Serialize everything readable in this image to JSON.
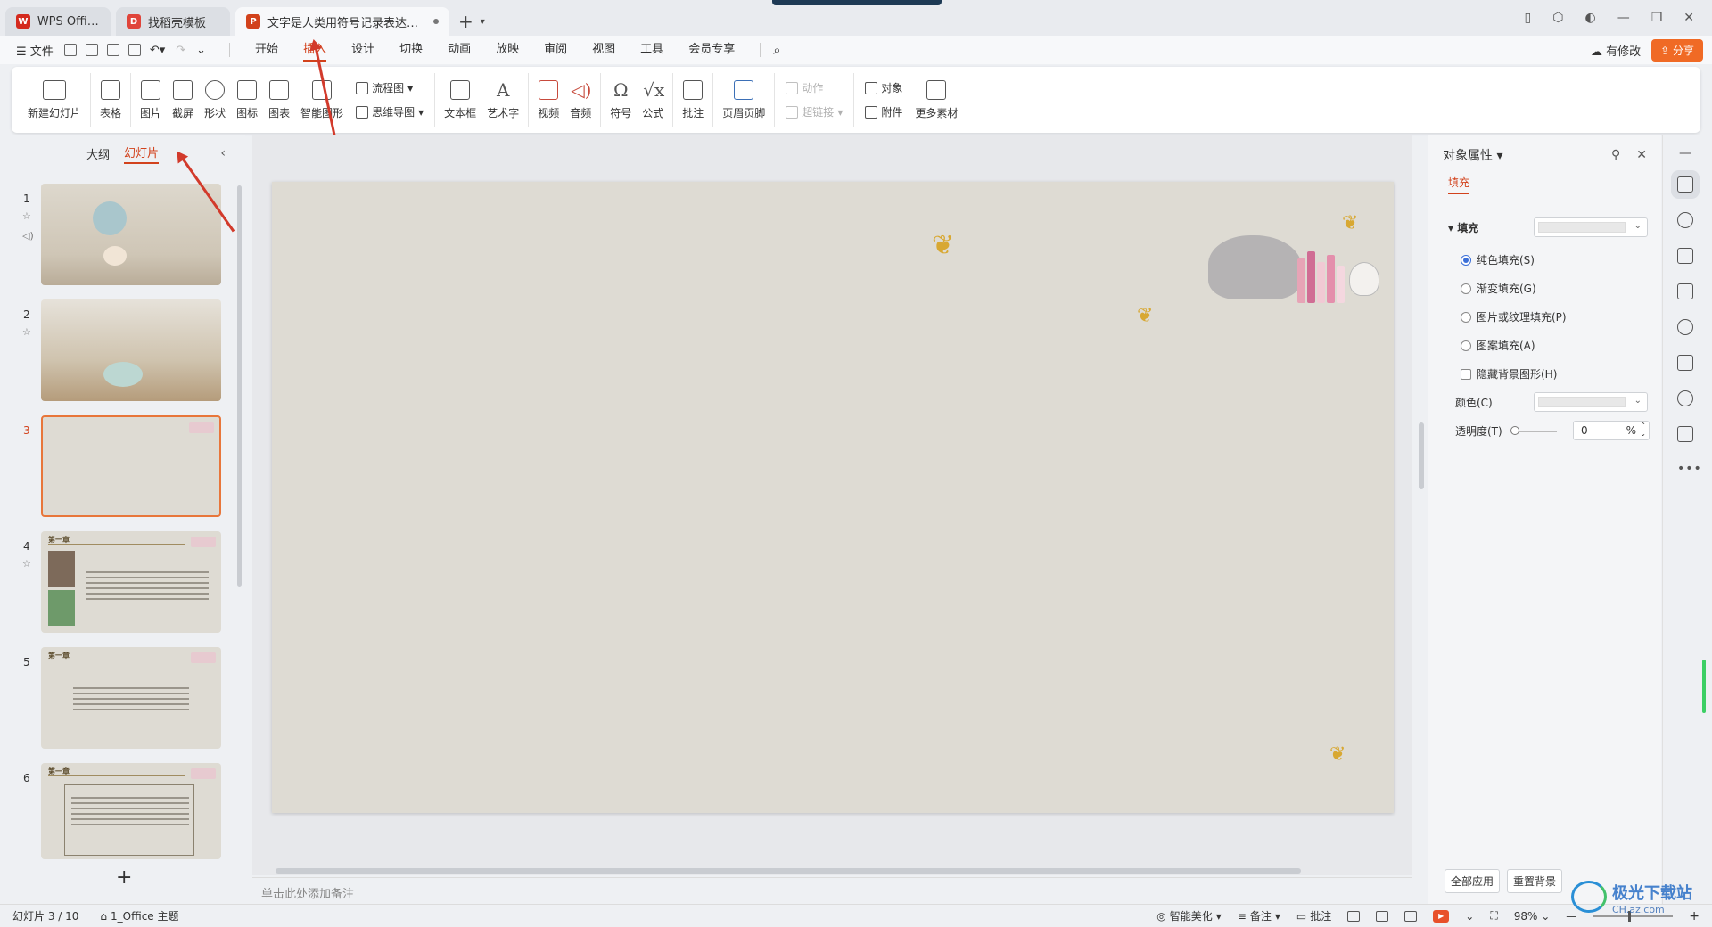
{
  "tabs": [
    {
      "label": "WPS Office",
      "logo": "W",
      "color": "#d42a1e"
    },
    {
      "label": "找稻壳模板",
      "logo": "D",
      "color": "#e0443a"
    },
    {
      "label": "文字是人类用符号记录表达信息以",
      "logo": "P",
      "color": "#d2421c"
    }
  ],
  "menubar": {
    "file": "文件",
    "tabs": [
      "开始",
      "插入",
      "设计",
      "切换",
      "动画",
      "放映",
      "审阅",
      "视图",
      "工具",
      "会员专享"
    ],
    "active_tab": "插入",
    "modified": "有修改",
    "share": "分享"
  },
  "ribbon": {
    "new_slide": "新建幻灯片",
    "table": "表格",
    "picture": "图片",
    "screenshot": "截屏",
    "shape": "形状",
    "icon": "图标",
    "chart": "图表",
    "smart_art": "智能图形",
    "flowchart": "流程图",
    "mindmap": "思维导图",
    "textbox": "文本框",
    "wordart": "艺术字",
    "video": "视频",
    "audio": "音频",
    "symbol": "符号",
    "formula": "公式",
    "comment": "批注",
    "header_footer": "页眉页脚",
    "action": "动作",
    "hyperlink": "超链接",
    "object": "对象",
    "attachment": "附件",
    "more_material": "更多素材"
  },
  "left_panel": {
    "tab_outline": "大纲",
    "tab_slides": "幻灯片",
    "slides": [
      {
        "num": "1"
      },
      {
        "num": "2"
      },
      {
        "num": "3"
      },
      {
        "num": "4",
        "title": "第一章"
      },
      {
        "num": "5",
        "title": "第一章"
      },
      {
        "num": "6",
        "title": "第一章"
      }
    ],
    "active_slide": "3"
  },
  "notes_placeholder": "单击此处添加备注",
  "right_panel": {
    "title": "对象属性",
    "tab": "填充",
    "section": "填充",
    "options": [
      "纯色填充(S)",
      "渐变填充(G)",
      "图片或纹理填充(P)",
      "图案填充(A)"
    ],
    "selected_option": 0,
    "hide_bg": "隐藏背景图形(H)",
    "color_label": "颜色(C)",
    "transparency_label": "透明度(T)",
    "transparency_value": "0",
    "percent": "%",
    "apply_all": "全部应用",
    "reset_bg": "重置背景",
    "transparency_level": 0
  },
  "statusbar": {
    "slide_info": "幻灯片 3 / 10",
    "theme": "1_Office 主题",
    "beautify": "智能美化",
    "notes": "备注",
    "comments": "批注",
    "zoom": "98%"
  },
  "watermark": {
    "name": "极光下载站",
    "sub": "CH.az.com"
  },
  "colors": {
    "accent": "#d2421c",
    "share": "#f06a25",
    "slide_bg": "#dedbd3",
    "annotation_arrow": "#d23a2b"
  }
}
